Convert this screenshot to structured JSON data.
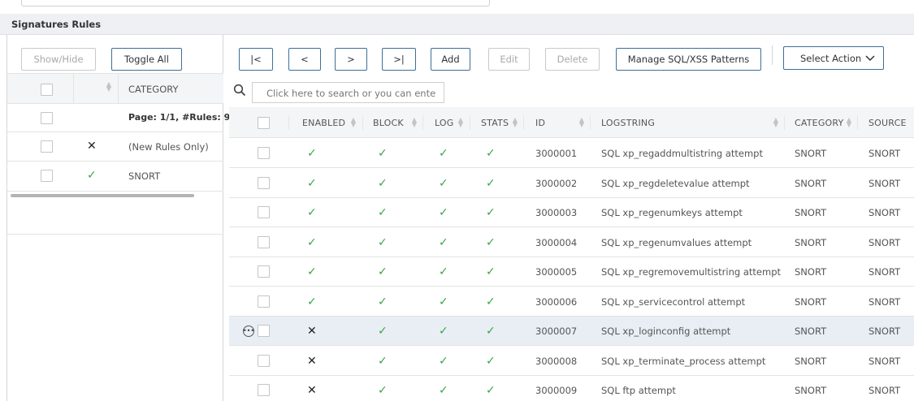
{
  "section": {
    "title": "Signatures Rules"
  },
  "left_panel": {
    "buttons": {
      "show_hide": "Show/Hide",
      "toggle_all": "Toggle All"
    },
    "header": {
      "category_label": "CATEGORY"
    },
    "page_info": "Page: 1/1, #Rules: 9",
    "rows": [
      {
        "mark": "x",
        "label": "(New Rules Only)"
      },
      {
        "mark": "check",
        "label": "SNORT"
      }
    ]
  },
  "toolbar": {
    "first": "|<",
    "prev": "<",
    "next": ">",
    "last": ">|",
    "add": "Add",
    "edit": "Edit",
    "delete": "Delete",
    "manage": "Manage SQL/XSS Patterns",
    "select_action": "Select Action"
  },
  "search": {
    "placeholder": "Click here to search or you can ente"
  },
  "grid": {
    "columns": [
      "ENABLED",
      "BLOCK",
      "LOG",
      "STATS",
      "ID",
      "LOGSTRING",
      "CATEGORY",
      "SOURCE"
    ],
    "rows": [
      {
        "enabled": "check",
        "block": "check",
        "log": "check",
        "stats": "check",
        "id": "3000001",
        "logstring": "SQL xp_regaddmultistring attempt",
        "category": "SNORT",
        "source": "SNORT"
      },
      {
        "enabled": "check",
        "block": "check",
        "log": "check",
        "stats": "check",
        "id": "3000002",
        "logstring": "SQL xp_regdeletevalue attempt",
        "category": "SNORT",
        "source": "SNORT"
      },
      {
        "enabled": "check",
        "block": "check",
        "log": "check",
        "stats": "check",
        "id": "3000003",
        "logstring": "SQL xp_regenumkeys attempt",
        "category": "SNORT",
        "source": "SNORT"
      },
      {
        "enabled": "check",
        "block": "check",
        "log": "check",
        "stats": "check",
        "id": "3000004",
        "logstring": "SQL xp_regenumvalues attempt",
        "category": "SNORT",
        "source": "SNORT"
      },
      {
        "enabled": "check",
        "block": "check",
        "log": "check",
        "stats": "check",
        "id": "3000005",
        "logstring": "SQL xp_regremovemultistring attempt",
        "category": "SNORT",
        "source": "SNORT"
      },
      {
        "enabled": "check",
        "block": "check",
        "log": "check",
        "stats": "check",
        "id": "3000006",
        "logstring": "SQL xp_servicecontrol attempt",
        "category": "SNORT",
        "source": "SNORT"
      },
      {
        "enabled": "cross",
        "block": "check",
        "log": "check",
        "stats": "check",
        "id": "3000007",
        "logstring": "SQL xp_loginconfig attempt",
        "category": "SNORT",
        "source": "SNORT",
        "selected": true
      },
      {
        "enabled": "cross",
        "block": "check",
        "log": "check",
        "stats": "check",
        "id": "3000008",
        "logstring": "SQL xp_terminate_process attempt",
        "category": "SNORT",
        "source": "SNORT"
      },
      {
        "enabled": "cross",
        "block": "check",
        "log": "check",
        "stats": "check",
        "id": "3000009",
        "logstring": "SQL ftp attempt",
        "category": "SNORT",
        "source": "SNORT"
      }
    ]
  },
  "colors": {
    "accent": "#3f6f95",
    "check": "#3aa646",
    "selected_row": "#e8eef4",
    "header_bg": "#eef0f3"
  }
}
